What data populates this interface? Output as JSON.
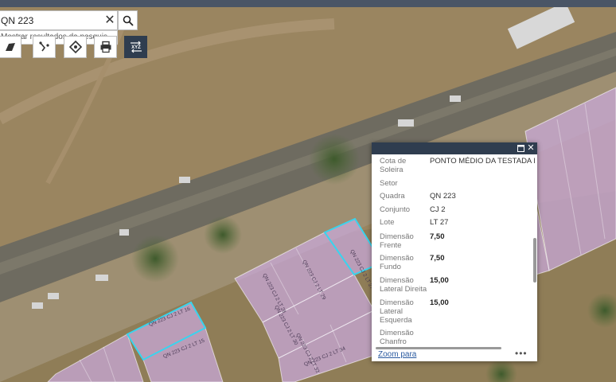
{
  "search": {
    "value": "QN 223",
    "suggestion": "Mostrar resultados da pesquis..."
  },
  "icons": {
    "clear": "close-icon",
    "search": "search-icon",
    "tools": [
      "basemap-icon",
      "measure-icon",
      "location-icon",
      "print-icon",
      "coordinate-xyz-icon"
    ],
    "xyz_label": "XYZ"
  },
  "map_labels": {
    "lot_a": "QN 223 CJ 2 LT 27",
    "lot_b": "QN 223 CJ 2 LT 16",
    "lot_c": "QN 223 CJ 2 LT 15",
    "lot_d": "QN 223 CJ 2 LT 28",
    "lot_e": "QN 223 CJ 2 LT 29",
    "lot_f": "QN 223 CJ 2 LT 30",
    "lot_g": "QN 223 CJ 2 LT 33",
    "lot_h": "QN 223 CJ 2 LT 34"
  },
  "popup": {
    "fields": [
      {
        "label": "Cota de Soleira",
        "value": "PONTO MÉDIO DA TESTADA F",
        "bold": false
      },
      {
        "label": "Setor",
        "value": "",
        "bold": false
      },
      {
        "label": "Quadra",
        "value": "QN 223",
        "bold": false
      },
      {
        "label": "Conjunto",
        "value": "CJ 2",
        "bold": false
      },
      {
        "label": "Lote",
        "value": "LT 27",
        "bold": false
      },
      {
        "label": "Dimensão Frente",
        "value": "7,50",
        "bold": true
      },
      {
        "label": "Dimensão Fundo",
        "value": "7,50",
        "bold": true
      },
      {
        "label": "Dimensão Lateral Direita",
        "value": "15,00",
        "bold": true
      },
      {
        "label": "Dimensão Lateral Esquerda",
        "value": "15,00",
        "bold": true
      },
      {
        "label": "Dimensão Chanfro",
        "value": "",
        "bold": false
      }
    ],
    "zoom": "Zoom para",
    "more": "•••"
  },
  "colors": {
    "parcel": "#c8a8d8",
    "highlight": "#39d4ee",
    "header": "#2f3d4f"
  }
}
